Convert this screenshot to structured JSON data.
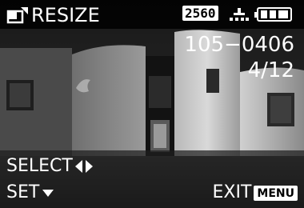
{
  "screen": {
    "title": "RESIZE",
    "resize_icon": "resize-frame-icon",
    "resolution_badge": "2560",
    "quality_icon": "fine-quality-icon",
    "battery_icon": "battery-full-icon",
    "file_number": "105−0406",
    "frame_counter": "4/12"
  },
  "footer": {
    "select_label": "SELECT",
    "select_icon": "left-right-arrows-icon",
    "set_label": "SET",
    "set_icon": "down-arrow-icon",
    "exit_label": "EXIT",
    "menu_key_label": "MENU"
  },
  "colors": {
    "osd_text": "#ffffff",
    "badge_bg": "#ffffff",
    "badge_text": "#000000"
  }
}
